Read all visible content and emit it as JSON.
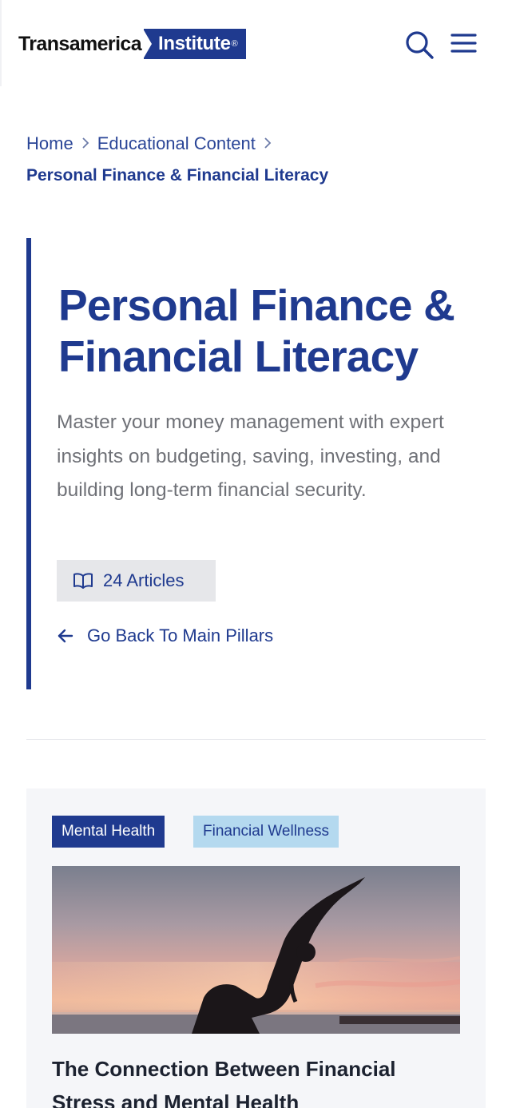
{
  "header": {
    "logo_word": "Transamerica",
    "logo_badge": "Institute",
    "logo_reg": "®"
  },
  "breadcrumb": {
    "home": "Home",
    "section": "Educational Content",
    "separator": ">",
    "current": "Personal Finance & Financial Literacy"
  },
  "hero": {
    "title": "Personal Finance & Financial Literacy",
    "description": "Master your money management with expert insights on budgeting, saving, investing, and building long-term financial security.",
    "article_count": "24 Articles",
    "back_link": "Go Back To Main Pillars"
  },
  "card": {
    "tags": [
      "Mental Health",
      "Financial Wellness"
    ],
    "title": "The Connection Between Financial Stress and Mental Health"
  },
  "colors": {
    "brand_navy": "#1f3a8f",
    "tag_light_blue": "#b4d9ef",
    "badge_gray": "#e6e7ea",
    "card_bg": "#f5f6f9"
  },
  "icons": {
    "search": "search-icon",
    "menu": "hamburger-menu-icon",
    "book": "open-book-icon",
    "back": "arrow-left-icon",
    "chevron": "chevron-right-icon"
  }
}
